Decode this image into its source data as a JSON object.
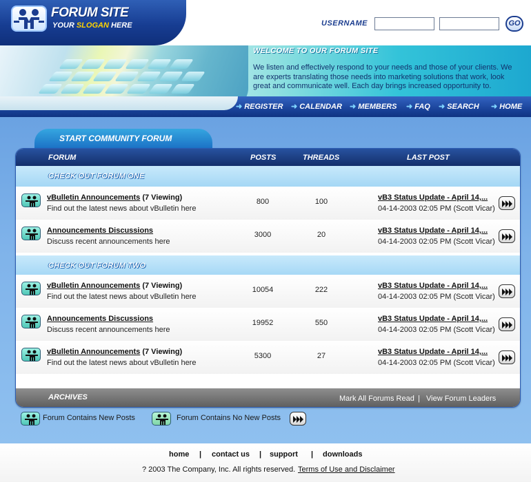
{
  "header": {
    "site_title": "FORUM SITE",
    "slogan_prefix": "YOUR",
    "slogan_highlight": "SLOGAN",
    "slogan_suffix": "HERE",
    "username_label": "USERNAME",
    "username_value": "",
    "password_value": "",
    "go_label": "GO"
  },
  "welcome": {
    "title": "WELCOME TO OUR FORUM SITE",
    "text": "We listen and effectively respond to your needs and those of your clients. We are experts translating those needs into marketing solutions that work, look great and communicate well. Each day brings increased opportunity to."
  },
  "nav": {
    "items": [
      "REGISTER",
      "CALENDAR",
      "MEMBERS",
      "FAQ",
      "SEARCH",
      "HOME"
    ]
  },
  "forum": {
    "tab_title": "START COMMUNITY FORUM",
    "columns": {
      "forum": "FORUM",
      "posts": "POSTS",
      "threads": "THREADS",
      "last_post": "LAST POST"
    },
    "sections": [
      {
        "title": "CHECK OUT  FORUM ONE",
        "rows": [
          {
            "title": "vBulletin Announcements",
            "viewing": "(7 Viewing)",
            "desc": "Find out the latest news about vBulletin here",
            "posts": "800",
            "threads": "100",
            "last_title": "vB3 Status Update - April 14,...",
            "last_meta": "04-14-2003 02:05 PM (Scott Vicar)"
          },
          {
            "title": "Announcements Discussions",
            "viewing": "",
            "desc": "Discuss recent announcements here",
            "posts": "3000",
            "threads": "20",
            "last_title": "vB3 Status Update - April 14,...",
            "last_meta": "04-14-2003 02:05 PM (Scott Vicar)"
          }
        ]
      },
      {
        "title": "CHECK OUT FORUM TWO",
        "rows": [
          {
            "title": "vBulletin Announcements",
            "viewing": "(7 Viewing)",
            "desc": "Find out the latest news about vBulletin here",
            "posts": "10054",
            "threads": "222",
            "last_title": "vB3 Status Update - April 14,...",
            "last_meta": "04-14-2003 02:05 PM (Scott Vicar)"
          },
          {
            "title": "Announcements Discussions",
            "viewing": "",
            "desc": "Discuss recent announcements here",
            "posts": "19952",
            "threads": "550",
            "last_title": "vB3 Status Update - April 14,...",
            "last_meta": "04-14-2003 02:05 PM (Scott Vicar)"
          },
          {
            "title": "vBulletin Announcements",
            "viewing": "(7 Viewing)",
            "desc": "Find out the latest news about vBulletin here",
            "posts": "5300",
            "threads": "27",
            "last_title": "vB3 Status Update - April 14,...",
            "last_meta": "04-14-2003 02:05 PM (Scott Vicar)"
          }
        ]
      }
    ],
    "footer_label": "ARCHIVES",
    "mark_read": "Mark All Forums Read",
    "separator": "|",
    "view_leaders": "View Forum Leaders"
  },
  "legend": {
    "new_posts": "Forum Contains New Posts",
    "no_new_posts": "Forum Contains No New Posts"
  },
  "footer": {
    "links": [
      "home",
      "contact us",
      "support",
      "downloads"
    ],
    "separator": "|",
    "copyright": "?  2003 The Company, Inc. All rights reserved.",
    "terms": "Terms of Use and Disclaimer "
  },
  "icons": {
    "forum_status": "forum-people-icon",
    "go_last": "double-arrow-right-icon",
    "nav_arrow": "arrow-right-icon"
  },
  "colors": {
    "header_navy": "#173d92",
    "banner_teal": "#33c3d9",
    "page_blue": "#7fb3ea",
    "section_light_blue": "#a4d7f5",
    "archives_gray": "#5c5c5c",
    "slogan_yellow": "#ffd400",
    "new_posts_icon": "#4fc6b6"
  }
}
